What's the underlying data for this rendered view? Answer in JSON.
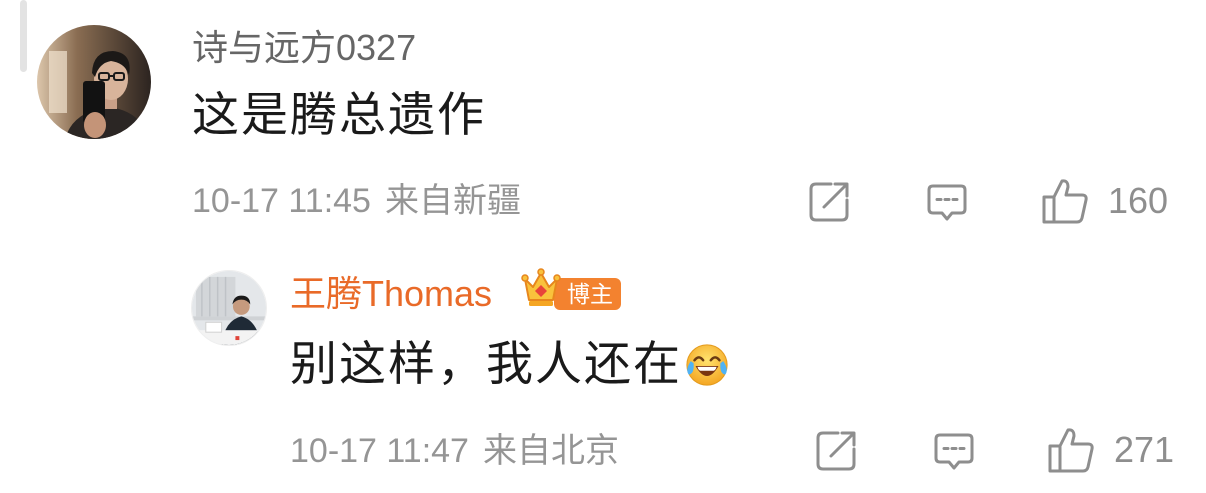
{
  "comment": {
    "username": "诗与远方0327",
    "text": "这是腾总遗作",
    "time": "10-17 11:45",
    "location": "来自新疆",
    "likes": "160"
  },
  "reply": {
    "username": "王腾Thomas",
    "badge": "博主",
    "text": "别这样，我人还在",
    "time": "10-17 11:47",
    "location": "来自北京",
    "likes": "271"
  },
  "icons": {
    "share": "share-icon",
    "comment": "comment-icon",
    "like": "thumbs-up-icon",
    "badge": "crown-icon",
    "emoji": "laugh-cry-emoji-icon"
  },
  "colors": {
    "username": "#666666",
    "blogger_username": "#e96a28",
    "text": "#1a1a1a",
    "meta": "#959595",
    "icon": "#8e8e8e",
    "badge_background": "#f3822f",
    "badge_crown": "#f9c23c"
  }
}
